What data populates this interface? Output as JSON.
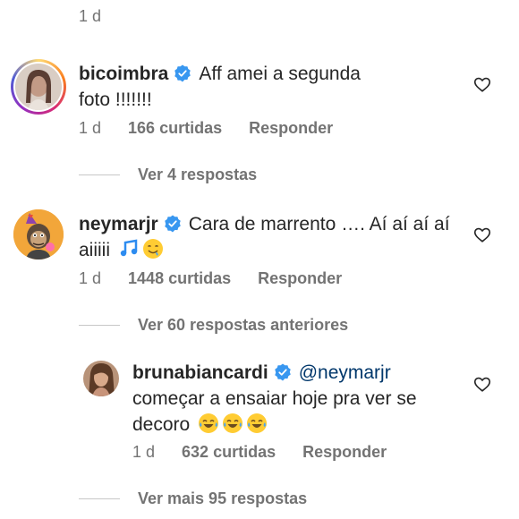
{
  "top_meta": {
    "time": "1 d"
  },
  "comments": [
    {
      "username": "bicoimbra",
      "text": "Aff amei a segunda foto !!!!!!!",
      "time": "1 d",
      "likes": "166 curtidas",
      "reply": "Responder",
      "view_replies": "Ver 4 respostas"
    },
    {
      "username": "neymarjr",
      "text": "Cara de marrento …. Aí aí aí aí aiiiii",
      "time": "1 d",
      "likes": "1448 curtidas",
      "reply": "Responder",
      "view_replies": "Ver 60 respostas anteriores"
    },
    {
      "username": "brunabiancardi",
      "mention": "@neymarjr",
      "text": "começar a ensaiar hoje pra ver se decoro",
      "time": "1 d",
      "likes": "632 curtidas",
      "reply": "Responder",
      "view_replies": "Ver mais 95 respostas"
    }
  ],
  "icons": {
    "verified": "verified-badge-icon",
    "like": "heart-outline-icon",
    "music": "music-note-emoji",
    "drool": "drooling-face-emoji",
    "laugh": "tears-of-joy-emoji"
  },
  "colors": {
    "verified_blue": "#3897f0",
    "secondary_text": "#737373",
    "mention": "#00376b",
    "story_ring": "#d62976"
  }
}
